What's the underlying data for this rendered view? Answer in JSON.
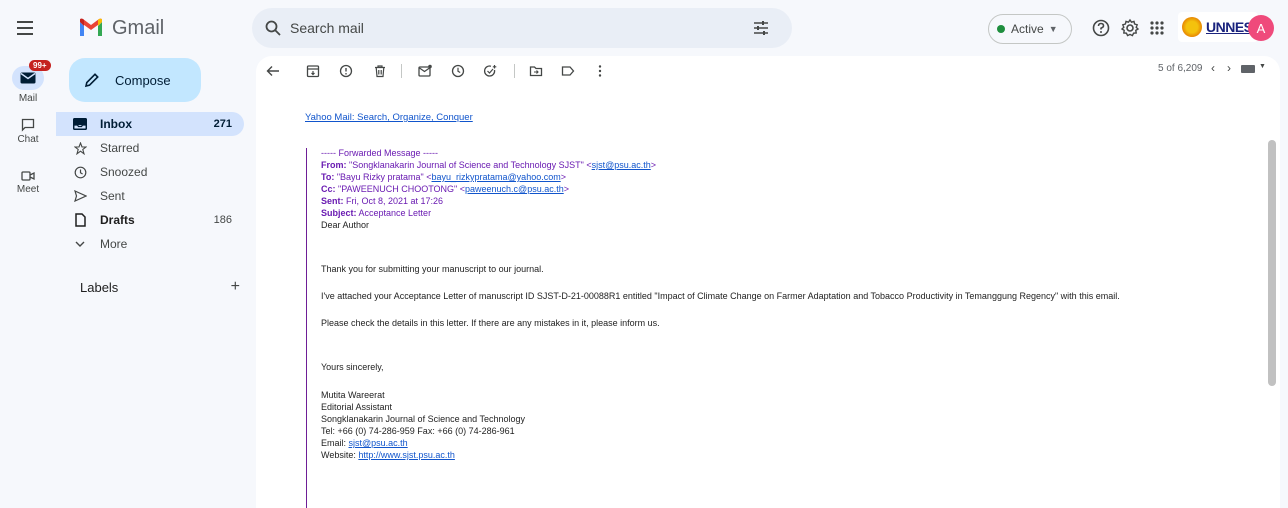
{
  "app": {
    "name": "Gmail"
  },
  "search": {
    "placeholder": "Search mail"
  },
  "status": {
    "label": "Active"
  },
  "account": {
    "org_label": "UNNES",
    "avatar_letter": "A"
  },
  "rail": {
    "mail_label": "Mail",
    "mail_badge": "99+",
    "chat_label": "Chat",
    "meet_label": "Meet"
  },
  "nav": {
    "compose_label": "Compose",
    "items": [
      {
        "label": "Inbox",
        "count": "271",
        "icon": "inbox-icon"
      },
      {
        "label": "Starred",
        "count": "",
        "icon": "star-icon"
      },
      {
        "label": "Snoozed",
        "count": "",
        "icon": "clock-icon"
      },
      {
        "label": "Sent",
        "count": "",
        "icon": "send-icon"
      },
      {
        "label": "Drafts",
        "count": "186",
        "icon": "draft-icon"
      },
      {
        "label": "More",
        "count": "",
        "icon": "chevron-down-icon"
      }
    ],
    "labels_heading": "Labels"
  },
  "toolbar": {
    "pager_text": "5 of 6,209"
  },
  "email": {
    "yahoo_link": "Yahoo Mail: Search, Organize, Conquer",
    "forwarded_header": "----- Forwarded Message -----",
    "from_key": "From:",
    "from_name": " \"Songklanakarin Journal of Science and Technology SJST\" <",
    "from_email": "sjst@psu.ac.th",
    "to_key": "To:",
    "to_name": " \"Bayu Rizky pratama\" <",
    "to_email": "bayu_rizkypratama@yahoo.com",
    "cc_key": "Cc:",
    "cc_name": " \"PAWEENUCH CHOOTONG\" <",
    "cc_email": "paweenuch.c@psu.ac.th",
    "sent_key": "Sent:",
    "sent_value": " Fri, Oct 8, 2021 at 17:26",
    "subject_key": "Subject:",
    "subject_value": " Acceptance Letter",
    "greeting": "Dear Author",
    "para1": "Thank you for submitting your manuscript to our journal.",
    "para2": "I've attached your Acceptance Letter of manuscript ID SJST-D-21-00088R1 entitled \"Impact of Climate Change on Farmer Adaptation and Tobacco Productivity in Temanggung Regency\" with this email.",
    "para3": "Please check the details in this letter. If there are any mistakes in it, please inform us.",
    "closing": "Yours sincerely,",
    "sig_name": "Mutita  Wareerat",
    "sig_title": "Editorial Assistant",
    "sig_org": "Songklanakarin Journal of Science and Technology",
    "sig_tel": "Tel: +66 (0) 74-286-959 Fax: +66 (0) 74-286-961",
    "sig_email_key": "Email: ",
    "sig_email": "sjst@psu.ac.th",
    "sig_web_key": "Website: ",
    "sig_web": "http://www.sjst.psu.ac.th"
  },
  "colors": {
    "compose_bg": "#c2e7ff",
    "selected_bg": "#d3e3fd",
    "forward_purple": "#6a1bb2",
    "link_blue": "#1155cc",
    "badge_red": "#c5221f",
    "active_green": "#1e8e3e"
  }
}
